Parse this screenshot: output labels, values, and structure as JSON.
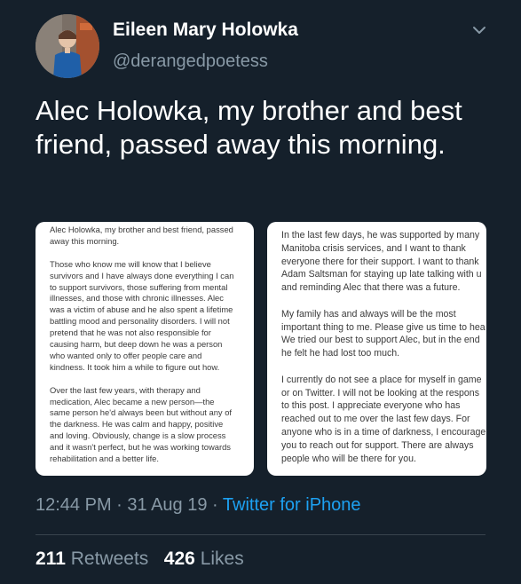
{
  "author": {
    "name": "Eileen Mary Holowka",
    "handle": "@derangedpoetess"
  },
  "tweet": {
    "text": "Alec Holowka, my brother and best friend, passed away this morning."
  },
  "image_left": {
    "paragraphs": [
      "Alec Holowka, my brother and best friend, passed\naway this morning.",
      "Those who know me will know that I believe\nsurvivors and I have always done everything I can\nto support survivors, those suffering from mental\nillnesses, and those with chronic illnesses. Alec\nwas a victim of abuse and he also spent a lifetime\nbattling mood and personality disorders. I will not\npretend that he was not also responsible for\ncausing harm, but deep down he was a person\nwho wanted only to offer people care and\nkindness. It took him a while to figure out how.",
      "Over the last few years, with therapy and\nmedication, Alec became a new person—the\nsame person he'd always been but without any of\nthe darkness. He was calm and happy, positive\nand loving. Obviously, change is a slow process\nand it wasn't perfect, but he was working towards\nrehabilitation and a better life."
    ]
  },
  "image_right": {
    "paragraphs": [
      "In the last few days, he was supported by many\nManitoba crisis services, and I want to thank\neveryone there for their support. I want to thank\nAdam Saltsman for staying up late talking with u\nand reminding Alec that there was a future.",
      "My family has and always will be the most\nimportant thing to me. Please give us time to hea\nWe tried our best to support Alec, but in the end\nhe felt he had lost too much.",
      "I currently do not see a place for myself in game\nor on Twitter. I will not be looking at the respons\nto this post. I appreciate everyone who has\nreached out to me over the last few days. For\nanyone who is in a time of darkness, I encourage\nyou to reach out for support. There are always\npeople who will be there for you."
    ]
  },
  "meta": {
    "time": "12:44 PM",
    "sep1": " · ",
    "date": "31 Aug 19",
    "sep2": " · ",
    "source": "Twitter for iPhone"
  },
  "stats": {
    "retweets_count": "211",
    "retweets_label": "Retweets",
    "likes_count": "426",
    "likes_label": "Likes"
  },
  "icons": {
    "menu": "chevron-down-icon"
  },
  "colors": {
    "background": "#15202b",
    "secondary_text": "#8899a6",
    "link": "#1da1f2",
    "divider": "#38444d"
  }
}
